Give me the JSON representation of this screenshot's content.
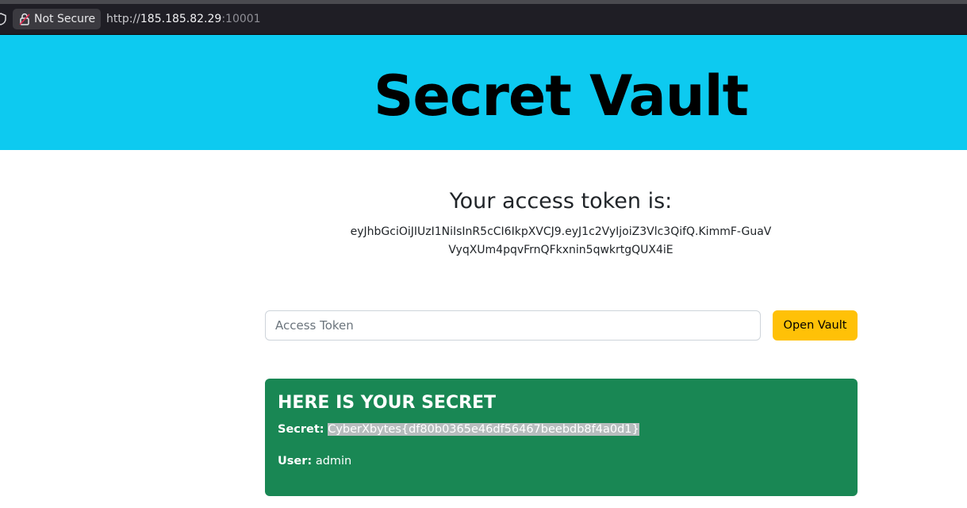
{
  "browser": {
    "security_label": "Not Secure",
    "url_scheme": "http://",
    "url_host": "185.185.82.29",
    "url_port": ":10001"
  },
  "header": {
    "title": "Secret Vault",
    "background_color": "#0dcaf0"
  },
  "token": {
    "heading": "Your access token is:",
    "value": "eyJhbGciOiJIUzI1NiIsInR5cCI6IkpXVCJ9.eyJ1c2VyIjoiZ3Vlc3QifQ.KimmF-GuaVVyqXUm4pqvFrnQFkxnin5qwkrtgQUX4iE"
  },
  "form": {
    "input_placeholder": "Access Token",
    "input_value": "",
    "button_label": "Open Vault",
    "button_color": "#ffc107"
  },
  "secret": {
    "title": "HERE IS YOUR SECRET",
    "secret_label": "Secret:",
    "secret_value": "CyberXbytes{df80b0365e46df56467beebdb8f4a0d1}",
    "user_label": "User:",
    "user_value": "admin",
    "card_color": "#198754"
  }
}
